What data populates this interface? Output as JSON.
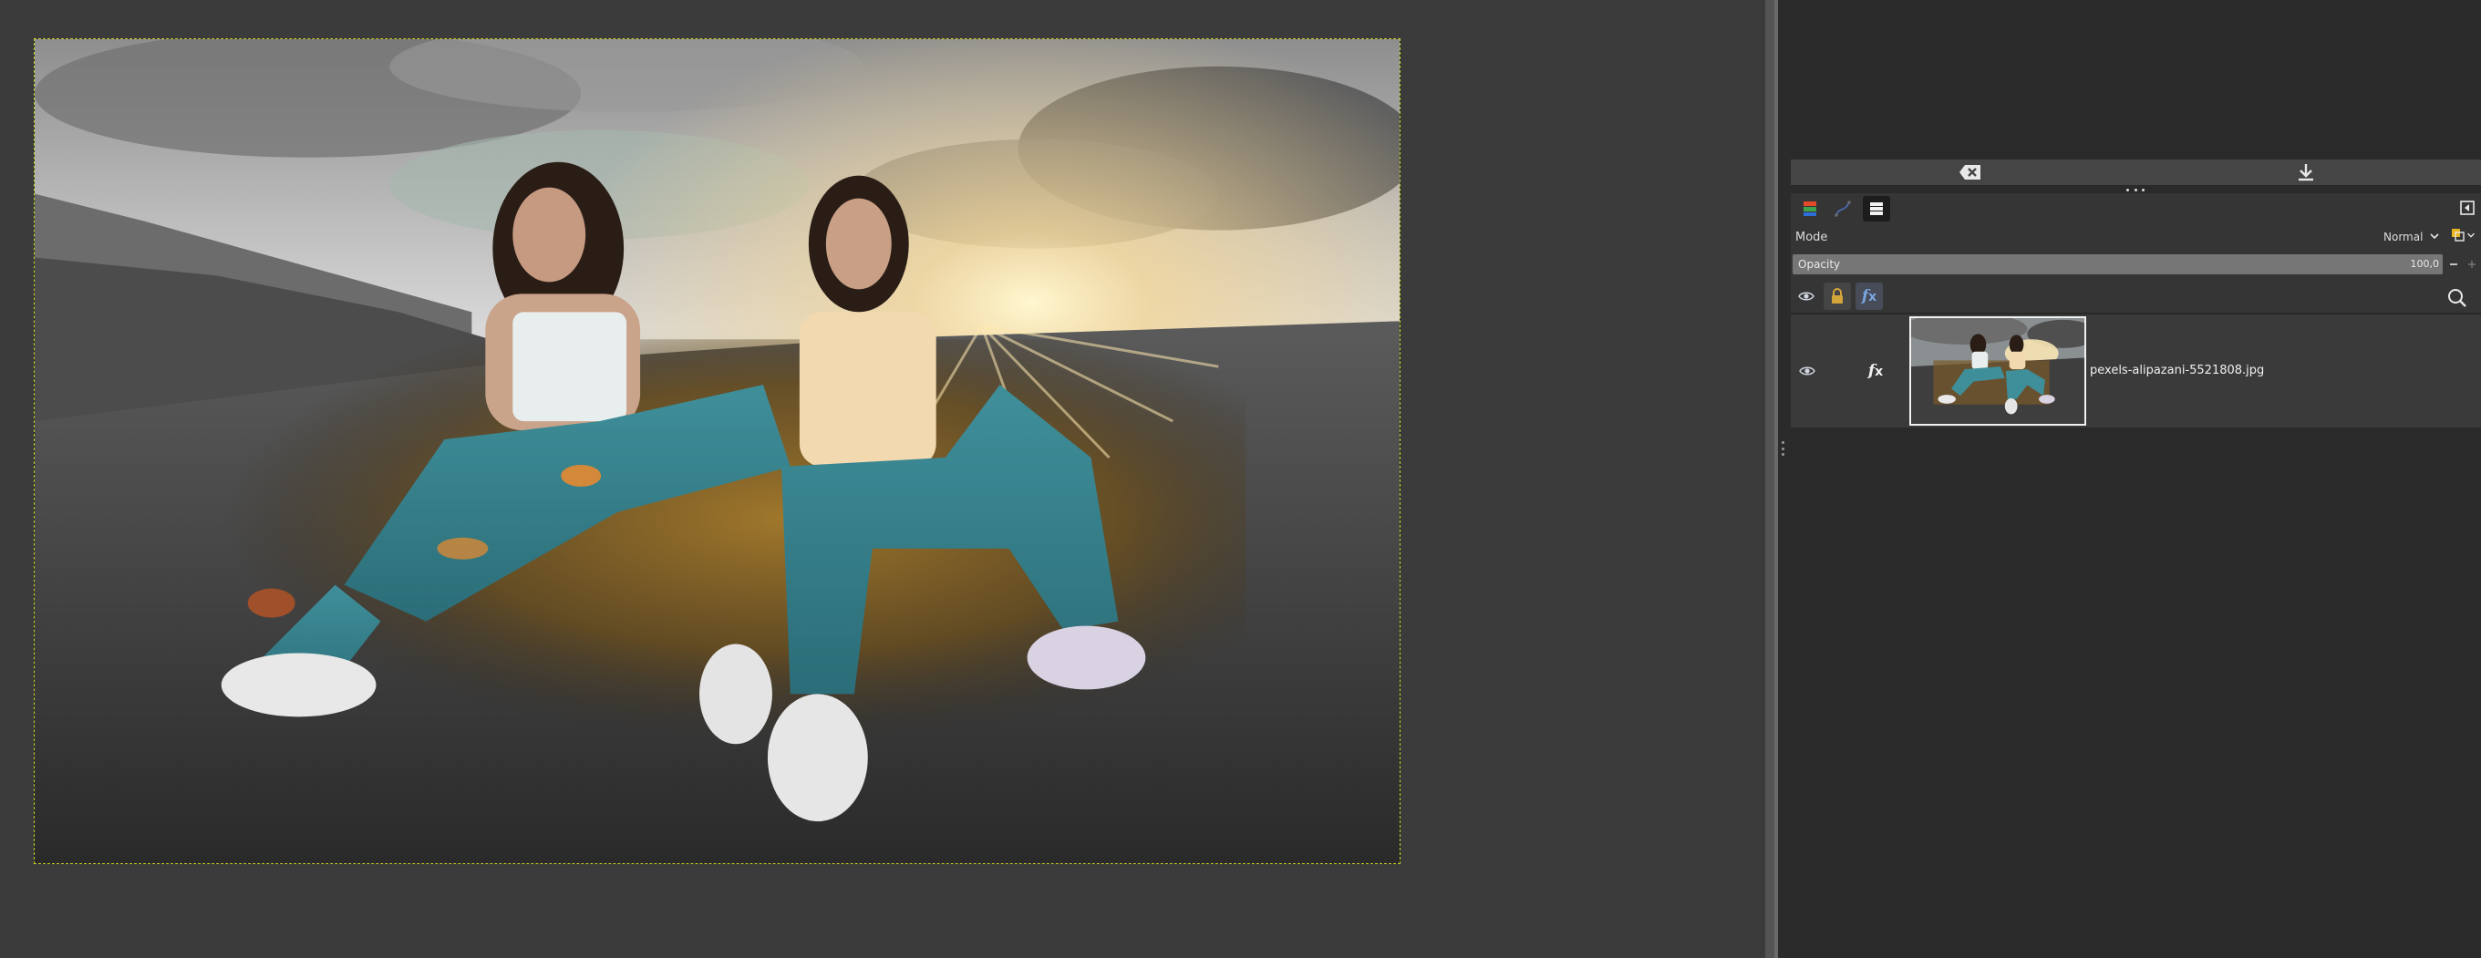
{
  "canvas": {
    "image_description_icon": "photo-two-women-sunset-icon"
  },
  "panel": {
    "dock_buttons": [
      {
        "icon": "clear-icon"
      },
      {
        "icon": "download-icon"
      }
    ],
    "tabs": [
      {
        "icon": "channels-icon",
        "active": false
      },
      {
        "icon": "paths-icon",
        "active": false
      },
      {
        "icon": "layers-icon",
        "active": true
      }
    ],
    "mode": {
      "label": "Mode",
      "value": "Normal"
    },
    "opacity": {
      "label": "Opacity",
      "value": "100,0",
      "level_percent": 100
    },
    "locks": [
      {
        "icon": "visibility-eye-icon"
      },
      {
        "icon": "lock-icon"
      },
      {
        "icon": "fx-icon"
      }
    ],
    "layers": [
      {
        "name": "pexels-alipazani-5521808.jpg",
        "visible": true,
        "has_effects": true
      }
    ],
    "colors": {
      "accent_yellow": "#e8b420",
      "lock_gold": "#d4a53a",
      "fx_blue": "#7aa6e0",
      "selection_border": "#c8d02a"
    }
  }
}
